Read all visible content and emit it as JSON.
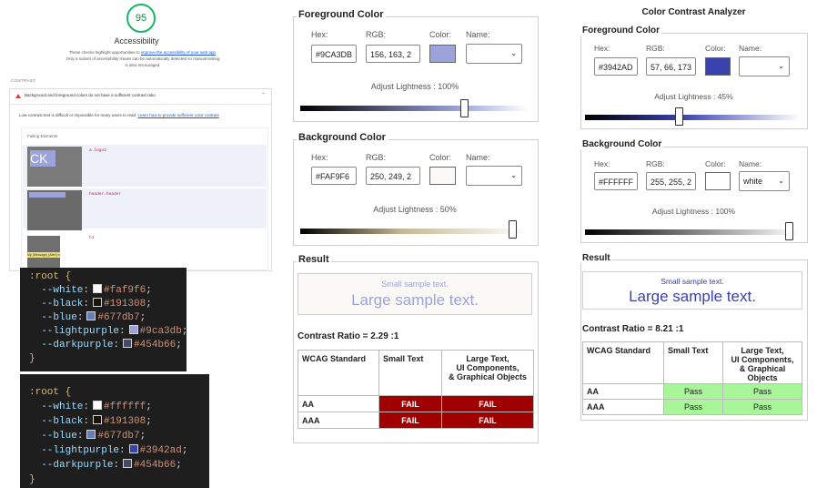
{
  "lighthouse": {
    "score": "95",
    "title": "Accessibility",
    "desc_pre": "These checks highlight opportunities to ",
    "desc_link": "improve the accessibility of your web app",
    "desc_post": ". Only a subset of accessibility issues can be automatically detected so manual testing is also encouraged.",
    "section_label": "CONTRAST",
    "audit_title": "Background and foreground colors do not have a sufficient contrast ratio",
    "audit_desc": "Low-contrast text is difficult or impossible for many users to read. ",
    "audit_link": "Learn how to provide sufficient color contrast",
    "failing_label": "Failing Elements",
    "thumb1_text": "CK",
    "items": [
      {
        "selector": "a.logo2"
      },
      {
        "selector": "header.header"
      },
      {
        "selector": "h1"
      }
    ],
    "thumb3_text": "My (Message) (Alert) her"
  },
  "code1": {
    "open": ":root {",
    "close": "}",
    "vars": [
      {
        "name": "--white",
        "value": "#faf9f6",
        "swatch": "#faf9f6"
      },
      {
        "name": "--black",
        "value": "#191308",
        "swatch": "#191308"
      },
      {
        "name": "--blue",
        "value": "#677db7",
        "swatch": "#677db7"
      },
      {
        "name": "--lightpurple",
        "value": "#9ca3db",
        "swatch": "#9ca3db"
      },
      {
        "name": "--darkpurple",
        "value": "#454b66",
        "swatch": "#454b66"
      }
    ]
  },
  "code2": {
    "open": ":root {",
    "close": "}",
    "vars": [
      {
        "name": "--white",
        "value": "#ffffff",
        "swatch": "#ffffff"
      },
      {
        "name": "--black",
        "value": "#191308",
        "swatch": "#191308"
      },
      {
        "name": "--blue",
        "value": "#677db7",
        "swatch": "#677db7"
      },
      {
        "name": "--lightpurple",
        "value": "#3942ad",
        "swatch": "#3942ad"
      },
      {
        "name": "--darkpurple",
        "value": "#454b66",
        "swatch": "#454b66"
      }
    ]
  },
  "toolA": {
    "fg": {
      "legend": "Foreground Color",
      "hex_label": "Hex:",
      "rgb_label": "RGB:",
      "color_label": "Color:",
      "name_label": "Name:",
      "hex": "#9CA3DB",
      "rgb": "156, 163, 2",
      "swatch": "#9ca3db",
      "name": "",
      "adjust": "Adjust Lightness : 100%",
      "lightness": 1.0
    },
    "bg": {
      "legend": "Background Color",
      "hex_label": "Hex:",
      "rgb_label": "RGB:",
      "color_label": "Color:",
      "name_label": "Name:",
      "hex": "#FAF9F6",
      "rgb": "250, 249, 2",
      "swatch": "#faf9f6",
      "name": "",
      "adjust": "Adjust Lightness : 50%",
      "lightness": 0.5
    },
    "result": {
      "legend": "Result",
      "small_sample": "Small sample text.",
      "large_sample": "Large sample text.",
      "fg": "#9ca3db",
      "bg": "#faf9f6",
      "ratio": "Contrast Ratio = 2.29 :1",
      "headers": {
        "std": "WCAG Standard",
        "small": "Small Text",
        "large1": "Large Text,",
        "large2": "UI Components,",
        "large3": "& Graphical Objects"
      },
      "rows": [
        {
          "std": "AA",
          "small": "FAIL",
          "large": "FAIL"
        },
        {
          "std": "AAA",
          "small": "FAIL",
          "large": "FAIL"
        }
      ]
    }
  },
  "toolB": {
    "title": "Color Contrast Analyzer",
    "fg": {
      "legend": "Foreground Color",
      "hex_label": "Hex:",
      "rgb_label": "RGB:",
      "color_label": "Color:",
      "name_label": "Name:",
      "hex": "#3942AD",
      "rgb": "57, 66, 173",
      "swatch": "#3942ad",
      "name": "",
      "adjust": "Adjust Lightness : 45%",
      "lightness": 0.45
    },
    "bg": {
      "legend": "Background Color",
      "hex_label": "Hex:",
      "rgb_label": "RGB:",
      "color_label": "Color:",
      "name_label": "Name:",
      "hex": "#FFFFFF",
      "rgb": "255, 255, 2",
      "swatch": "#ffffff",
      "name": "white",
      "adjust": "Adjust Lightness : 100%",
      "lightness": 1.0
    },
    "result": {
      "legend": "Result",
      "small_sample": "Small sample text.",
      "large_sample": "Large sample text.",
      "fg": "#3942ad",
      "bg": "#ffffff",
      "ratio": "Contrast Ratio = 8.21 :1",
      "headers": {
        "std": "WCAG Standard",
        "small": "Small Text",
        "large1": "Large Text,",
        "large2": "UI Components,",
        "large3": "& Graphical Objects"
      },
      "rows": [
        {
          "std": "AA",
          "small": "Pass",
          "large": "Pass"
        },
        {
          "std": "AAA",
          "small": "Pass",
          "large": "Pass"
        }
      ]
    }
  }
}
